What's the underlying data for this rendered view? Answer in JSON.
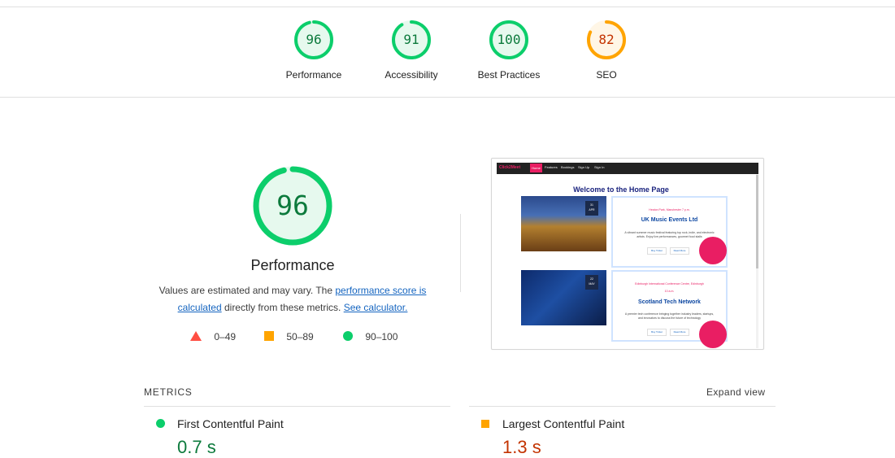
{
  "colors": {
    "pass": "#0cce6b",
    "pass_text": "#0c7a3c",
    "average": "#ffa400",
    "average_text": "#c33300",
    "fail": "#ff4e42",
    "link": "#1565c0"
  },
  "summary": [
    {
      "label": "Performance",
      "score": "96",
      "score_fraction": 0.96,
      "rating": "pass"
    },
    {
      "label": "Accessibility",
      "score": "91",
      "score_fraction": 0.91,
      "rating": "pass"
    },
    {
      "label": "Best Practices",
      "score": "100",
      "score_fraction": 1.0,
      "rating": "pass"
    },
    {
      "label": "SEO",
      "score": "82",
      "score_fraction": 0.82,
      "rating": "average"
    }
  ],
  "main": {
    "score": "96",
    "score_fraction": 0.96,
    "title": "Performance",
    "desc_before": "Values are estimated and may vary. The ",
    "desc_link1": "performance score is calculated",
    "desc_middle": " directly from these metrics. ",
    "desc_link2": "See calculator."
  },
  "legend": [
    {
      "shape": "triangle-icon",
      "range": "0–49"
    },
    {
      "shape": "square-icon",
      "range": "50–89"
    },
    {
      "shape": "circle-icon",
      "range": "90–100"
    }
  ],
  "preview": {
    "brand": "Click2Meet",
    "nav": [
      "Home",
      "Features",
      "Bookings",
      "Sign Up",
      "Sign In"
    ],
    "heading": "Welcome to the Home Page",
    "events": [
      {
        "date_day": "31",
        "date_month": "APR",
        "location": "Heaton Park, Manchester",
        "time": "7 p.m.",
        "title": "UK Music Events Ltd",
        "text": "A vibrant summer music festival featuring top rock, indie, and electronic artists. Enjoy live performances, gourmet food stalls",
        "btn1": "Buy Ticket",
        "btn2": "Read More"
      },
      {
        "date_day": "22",
        "date_month": "MAY",
        "location": "Edinburgh International Conference Centre, Edinburgh",
        "time": "10 a.m.",
        "title": "Scotland Tech Network",
        "text": "A premier tech conference bringing together industry leaders, startups, and innovators to discuss the future of technology",
        "btn1": "Buy Ticket",
        "btn2": "Read More"
      }
    ]
  },
  "metrics": {
    "header": "METRICS",
    "expand": "Expand view",
    "items": [
      {
        "name": "First Contentful Paint",
        "value": "0.7 s",
        "rating": "pass"
      },
      {
        "name": "Largest Contentful Paint",
        "value": "1.3 s",
        "rating": "average"
      }
    ]
  }
}
